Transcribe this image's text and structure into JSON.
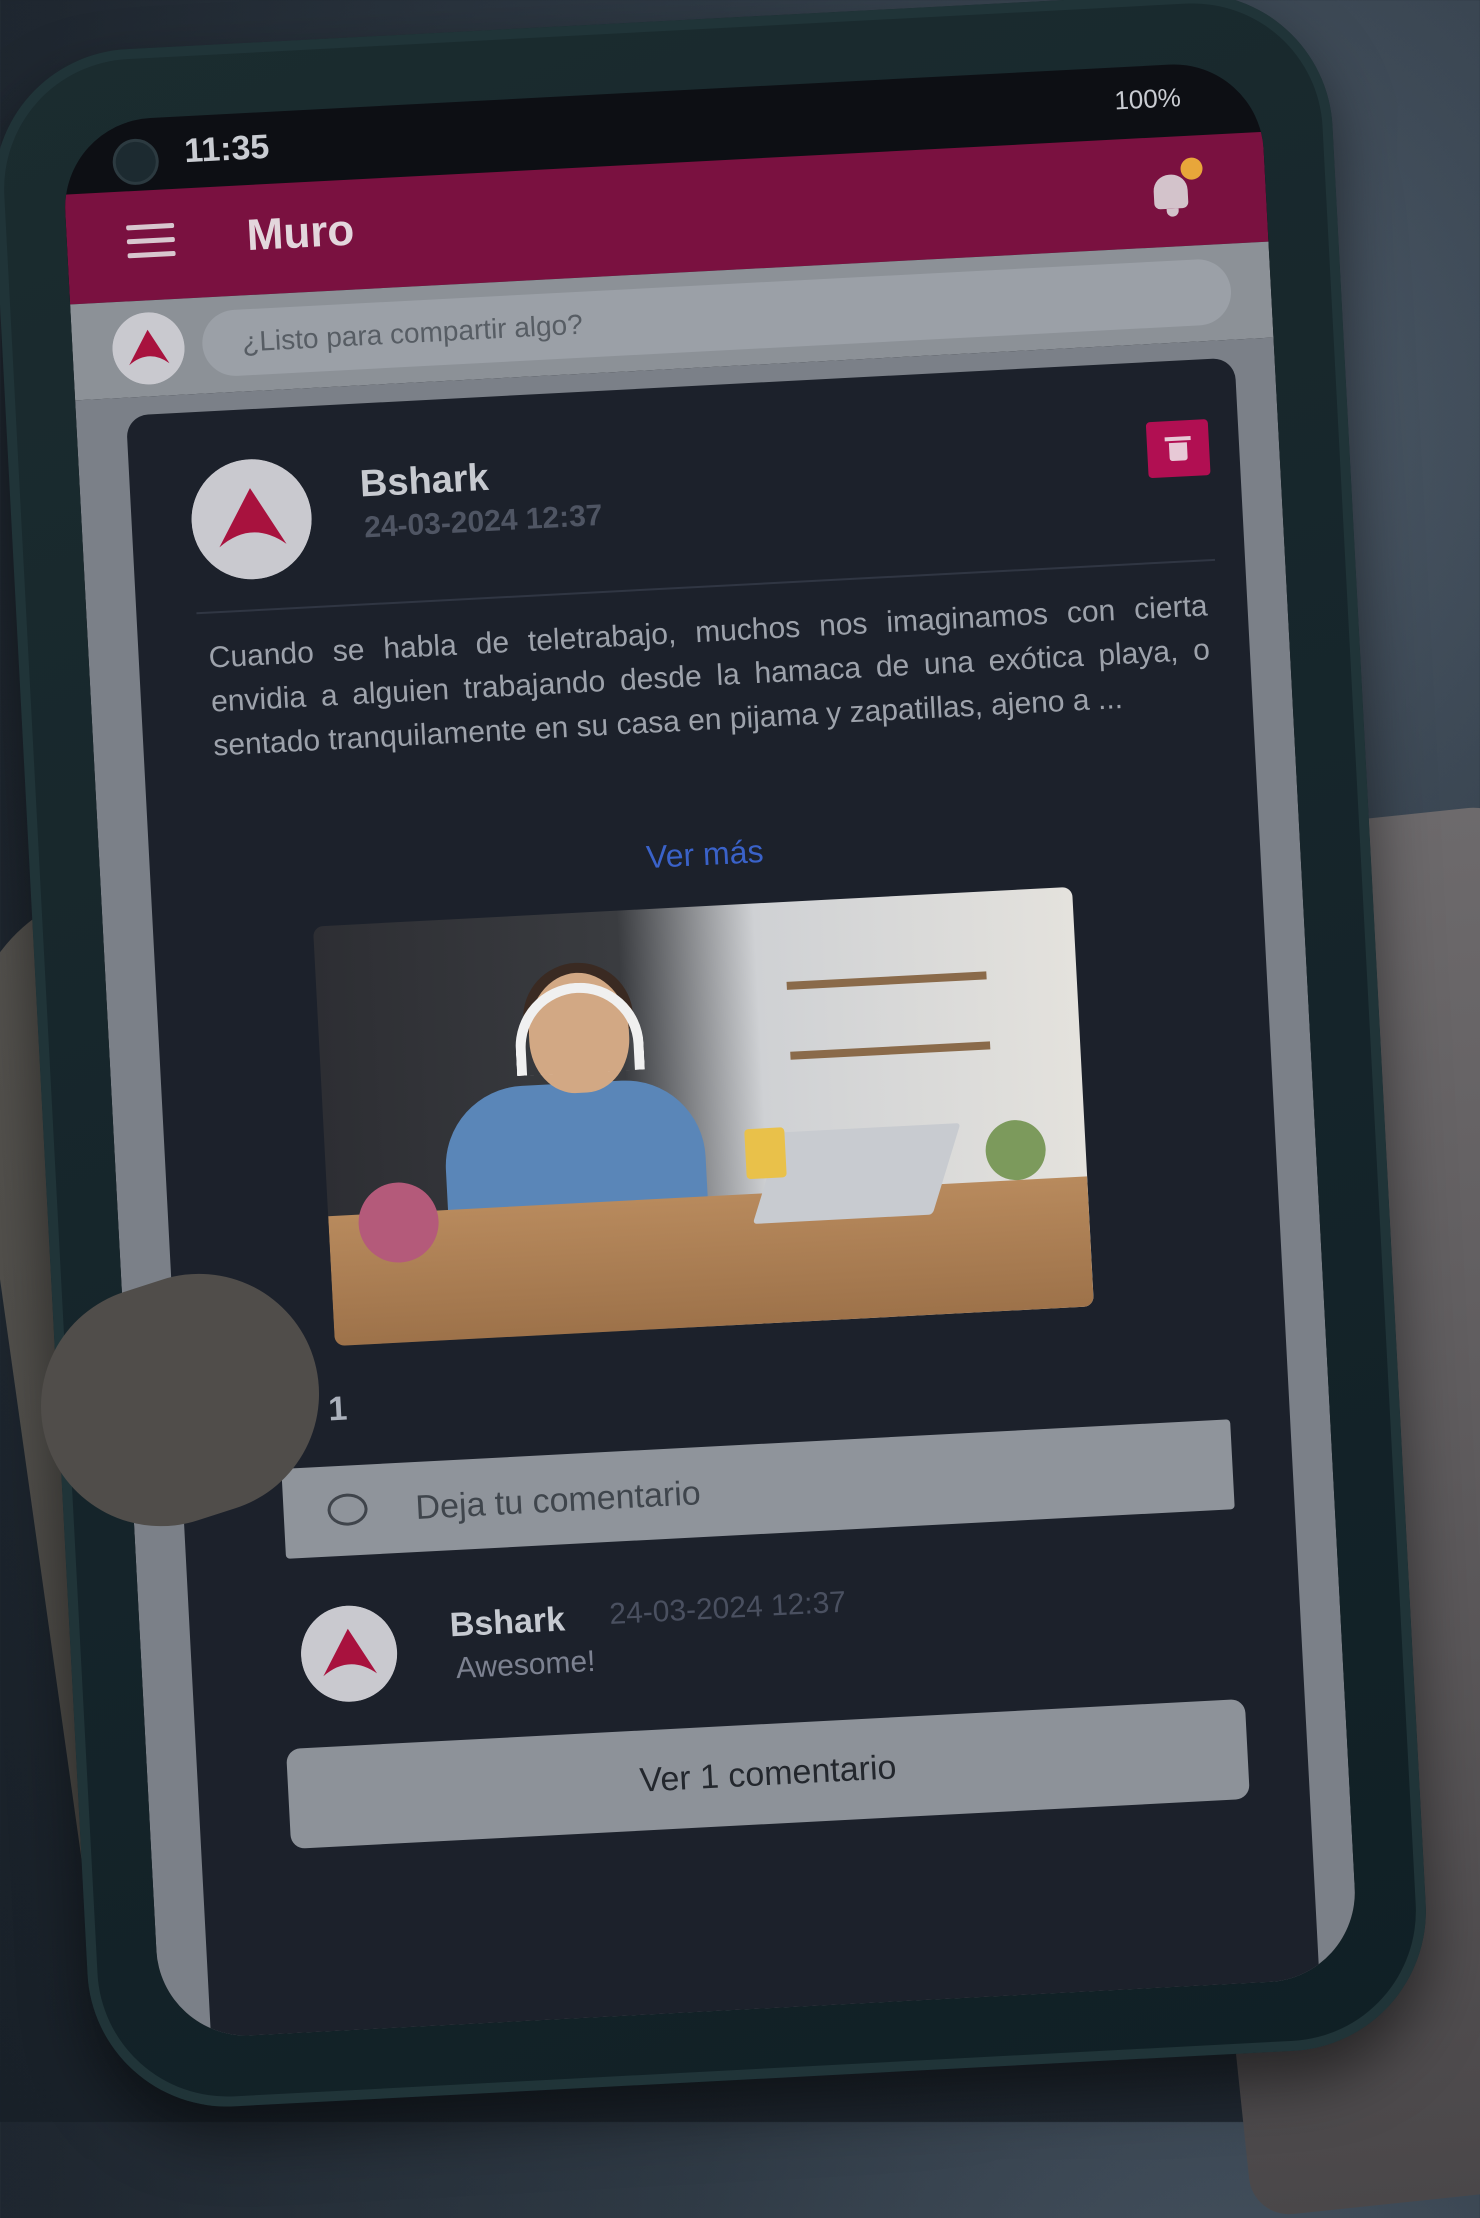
{
  "status": {
    "time": "11:35",
    "battery": "100%"
  },
  "appbar": {
    "title": "Muro"
  },
  "composer": {
    "placeholder": "¿Listo para compartir algo?"
  },
  "post": {
    "author": "Bshark",
    "date": "24-03-2024 12:37",
    "text": "Cuando se habla de teletrabajo, muchos nos imaginamos con cierta envidia a alguien trabajando desde la hamaca de una exótica playa, o sentado tranquilamente en su casa en pijama y zapatillas, ajeno a ...",
    "see_more": "Ver más",
    "likes": "1"
  },
  "comment_input": {
    "placeholder": "Deja tu comentario"
  },
  "comment": {
    "author": "Bshark",
    "date": "24-03-2024 12:37",
    "text": "Awesome!"
  },
  "view_comments_label": "Ver 1 comentario",
  "colors": {
    "appbar": "#7a1140",
    "accent": "#b10f52",
    "card": "#1c212b",
    "link": "#3a62c9"
  },
  "icons": [
    "menu-icon",
    "bell-icon",
    "trash-icon",
    "heart-icon",
    "comment-bubble-icon",
    "shark-logo"
  ]
}
